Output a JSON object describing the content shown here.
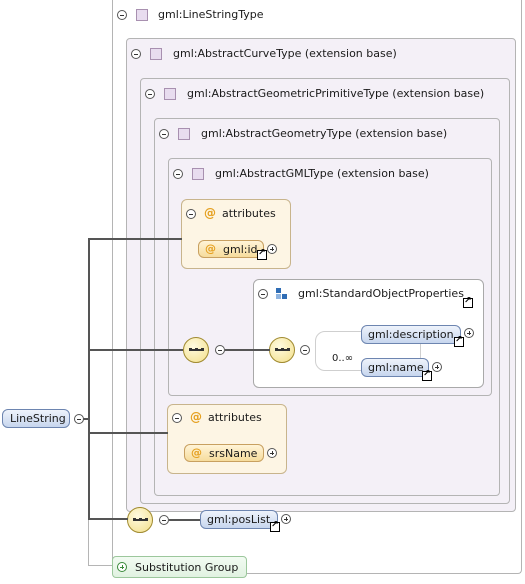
{
  "root_element": "LineString",
  "types": [
    "gml:LineStringType",
    "gml:AbstractCurveType (extension base)",
    "gml:AbstractGeometricPrimitiveType (extension base)",
    "gml:AbstractGeometryType (extension base)",
    "gml:AbstractGMLType (extension base)"
  ],
  "gml_attributes": {
    "label": "attributes",
    "items": [
      "gml:id"
    ]
  },
  "standard_props": {
    "group": "gml:StandardObjectProperties",
    "cardinality": "0..∞",
    "items": [
      "gml:description",
      "gml:name"
    ]
  },
  "geometry_attributes": {
    "label": "attributes",
    "items": [
      "srsName"
    ]
  },
  "pos_list": "gml:posList",
  "substitution_group": "Substitution Group",
  "colors": {
    "type_fill": "#f4f0f7",
    "element_fill": "#c7d6ee",
    "attribute_fill": "#fdf5e4",
    "substitution_fill": "#e1f2e1"
  }
}
